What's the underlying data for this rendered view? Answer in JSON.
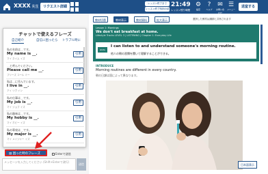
{
  "topbar": {
    "user_name": "XXXX",
    "user_suffix": "先生",
    "request_button": "リクエスト詳細",
    "session_pill_1": "レッスン終了まで",
    "session_pill_2": "レッスン終了時刻の延長",
    "clock": "21:49",
    "clock_sub": "レッスン残り時間",
    "icons": [
      {
        "name": "setting",
        "label": "設定"
      },
      {
        "name": "help",
        "label": "ヘルプ"
      },
      {
        "name": "contact",
        "label": "お問い合わせ"
      },
      {
        "name": "menu",
        "label": "メニュー"
      }
    ],
    "logout_button": "退室する"
  },
  "popup": {
    "title": "チャットで使えるフレーズ",
    "tabs": [
      "自己紹介",
      "自信に困ったら",
      "トラブル時に"
    ],
    "use_label": "引用",
    "phrases": [
      {
        "pre": "私の名前は＿です。",
        "en": "My name is __.",
        "kana": "マイ ネイム イズ"
      },
      {
        "pre": "＿と呼んでください。",
        "en": "Please call me __.",
        "kana": "プリーズ コール ミー"
      },
      {
        "pre": "私は＿に住んでいます。",
        "en": "I live in __.",
        "kana": "アイ リヴ イン"
      },
      {
        "pre": "私の仕事は＿です。",
        "en": "My job is __.",
        "kana": "マイ ジョブ イズ"
      },
      {
        "pre": "私の趣味は＿です。",
        "en": "My hobby is __.",
        "kana": "マイ ホビー イズ"
      },
      {
        "pre": "私の専攻は＿です。",
        "en": "My major is __.",
        "kana": "マイ メイジャー イズ"
      }
    ]
  },
  "chat": {
    "trouble_button": "困った時のフレーズ",
    "enter_send_label": "Enterで送信",
    "input_placeholder": "メッセージを入力してください (Shift+Enterで改行)",
    "send_button": "送信"
  },
  "content": {
    "tabs": [
      "教材切替",
      "教材表示",
      "教材資料",
      "拡大表示"
    ],
    "tab_note": "選択した教材は講師と共有されます",
    "lesson": {
      "level_line": "Lesson 1: Mornings",
      "title": "We don't eat breakfast at home.",
      "sub": "Lifestyle Tracks LEVEL 3 | LISTENING | Chapter 1: Everyday Life",
      "goal_tag": "GOAL",
      "goal_en": "I can listen to and understand someone's morning routine.",
      "goal_ja": "他人の朝の習慣を聞いて理解することができる。"
    },
    "intro_heading": "INTRODUCE",
    "intro_en": "Morning routines are different in every country.",
    "intro_ja": "朝の日課は国によって異なります。",
    "translate_button": "日本語表示"
  },
  "colors": {
    "navy": "#1e4f87",
    "teal": "#1f7a6e",
    "highlight_red": "#e02020"
  }
}
